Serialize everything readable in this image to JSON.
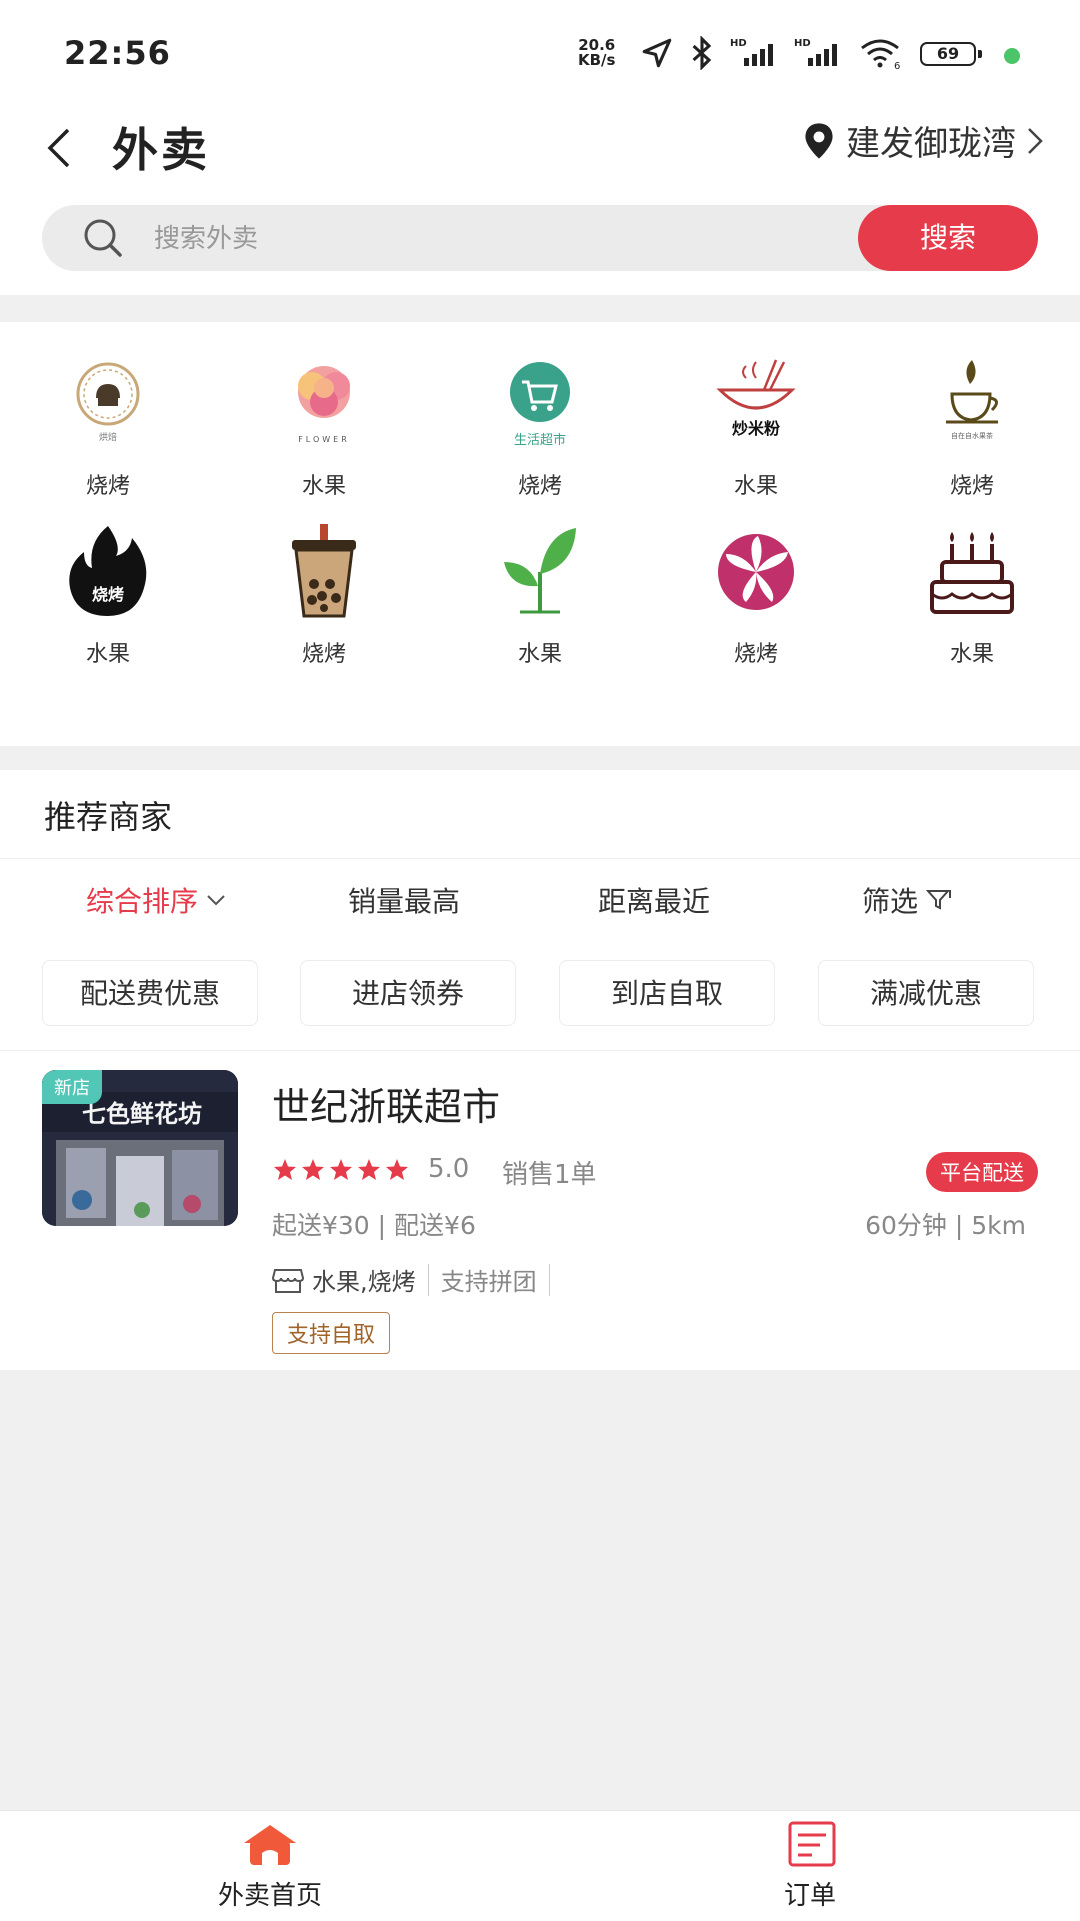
{
  "status_bar": {
    "time": "22:56",
    "net_speed_top": "20.6",
    "net_speed_bottom": "KB/s",
    "battery": "69"
  },
  "header": {
    "title": "外卖",
    "location": "建发御珑湾"
  },
  "search": {
    "placeholder": "搜索外卖",
    "button_label": "搜索"
  },
  "categories": [
    {
      "label": "烧烤",
      "icon": "bakery-logo-icon"
    },
    {
      "label": "水果",
      "icon": "rose-flower-icon"
    },
    {
      "label": "烧烤",
      "icon": "shopping-cart-icon"
    },
    {
      "label": "水果",
      "icon": "noodle-bowl-icon"
    },
    {
      "label": "烧烤",
      "icon": "tea-cup-icon"
    },
    {
      "label": "水果",
      "icon": "flame-bbq-icon"
    },
    {
      "label": "烧烤",
      "icon": "bubble-tea-icon"
    },
    {
      "label": "水果",
      "icon": "sprout-icon"
    },
    {
      "label": "烧烤",
      "icon": "lily-flower-icon"
    },
    {
      "label": "水果",
      "icon": "birthday-cake-icon"
    }
  ],
  "category_texts": {
    "supermarket": "生活超市",
    "noodles": "炒米粉",
    "flower": "FLOWER",
    "bbq": "烧烤",
    "bakery": "烘焙",
    "tea": "自在自水果茶"
  },
  "recommend": {
    "title": "推荐商家",
    "sort_tabs": [
      "综合排序",
      "销量最高",
      "距离最近",
      "筛选"
    ],
    "active_sort": "综合排序",
    "chips": [
      "配送费优惠",
      "进店领券",
      "到店自取",
      "满减优惠"
    ]
  },
  "shop": {
    "badge": "新店",
    "sign_text": "七色鲜花坊",
    "name": "世纪浙联超市",
    "rating": "5.0",
    "stars": 5,
    "sales": "销售1单",
    "delivery_tag": "平台配送",
    "fees": "起送¥30 | 配送¥6",
    "eta": "60分钟 | 5km",
    "categories": "水果,烧烤",
    "group_buy": "支持拼团",
    "self_pickup": "支持自取"
  },
  "bottom_nav": {
    "home": "外卖首页",
    "orders": "订单"
  },
  "colors": {
    "accent": "#e63b4a",
    "badge_teal": "#52c7b7",
    "pickup_brown": "#a0642a"
  }
}
